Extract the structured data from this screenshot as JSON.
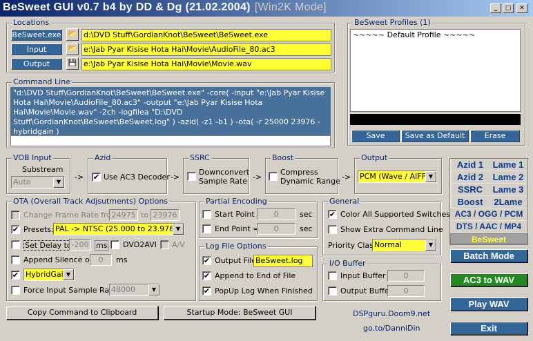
{
  "window": {
    "title": "BeSweet GUI v0.7 b4 by DD & Dg (21.02.2004)",
    "mode": "[Win2K Mode]"
  },
  "locations": {
    "title": "Locations",
    "rows": [
      {
        "label": "BeSweet.exe",
        "path": "d:\\DVD Stuff\\GordianKnot\\BeSweet\\BeSweet.exe"
      },
      {
        "label": "Input",
        "path": "e:\\Jab Pyar Kisise Hota Hai\\Movie\\AudioFile_80.ac3"
      },
      {
        "label": "Output",
        "path": "e:\\Jab Pyar Kisise Hota Hai\\Movie\\Movie.wav"
      }
    ]
  },
  "command_line": {
    "title": "Command Line",
    "text": "\"d:\\DVD Stuff\\GordianKnot\\BeSweet\\BeSweet.exe\" -core( -input \"e:\\Jab Pyar Kisise Hota Hai\\Movie\\AudioFile_80.ac3\" -output \"e:\\Jab Pyar Kisise Hota Hai\\Movie\\Movie.wav\" -2ch -logfilea \"D:\\DVD Stuff\\GordianKnot\\BeSweet\\BeSweet.log\" ) -azid( -z1 -b1 ) -ota( -r 25000 23976 -hybridgain )"
  },
  "profiles": {
    "title": "BeSweet Profiles (1)",
    "items": [
      "~~~~~ Default Profile ~~~~~"
    ],
    "save": "Save",
    "save_default": "Save as Default",
    "erase": "Erase"
  },
  "vob": {
    "title": "VOB Input",
    "substream": "Substream",
    "value": "Auto"
  },
  "azid": {
    "title": "Azid",
    "use_ac3": "Use AC3 Decoder"
  },
  "ssrc": {
    "title": "SSRC",
    "downconvert": "Downconvert",
    "sample_rate": "Sample Rate"
  },
  "boost": {
    "title": "Boost",
    "compress": "Compress",
    "dynamic": "Dynamic Range"
  },
  "output": {
    "title": "Output",
    "value": "PCM (Wave / AIFF"
  },
  "arrows": {
    "a1": "->",
    "a2": "->",
    "a3": "->",
    "a4": "->"
  },
  "ota": {
    "title": "OTA (Overall Track Adjsutments) Options",
    "change_rate": "Change Frame Rate from",
    "from": "24975",
    "to_label": "to",
    "to": "23976",
    "presets_label": "Presets:",
    "presets_value": "PAL    -> NTSC (25.000 to 23.976)",
    "set_delay": "Set Delay to",
    "delay": "-200",
    "ms": "ms",
    "dvd2avi": "DVD2AVI",
    "av": "A/V",
    "append_silence": "Append Silence of",
    "silence": "0",
    "silence_ms": "ms",
    "hybrid": "HybridGain",
    "force_rate": "Force Input Sample Rate",
    "rate": "48000"
  },
  "partial": {
    "title": "Partial Encoding",
    "start": "Start Point =",
    "start_val": "0",
    "end": "End Point =",
    "end_val": "0",
    "sec": "sec"
  },
  "log": {
    "title": "Log File Options",
    "output_file": "Output File",
    "file": "BeSweet.log",
    "append": "Append to End of File",
    "popup": "PopUp Log When Finished"
  },
  "general": {
    "title": "General",
    "color": "Color All Supported Switches",
    "extra": "Show Extra Command Line",
    "priority": "Priority Class",
    "priority_value": "Normal"
  },
  "io": {
    "title": "I/O Buffer",
    "input": "Input Buffer",
    "input_val": "0",
    "output": "Output Buffer",
    "output_val": "0"
  },
  "presets": [
    "Azid 1",
    "Lame 1",
    "Azid 2",
    "Lame 2",
    "SSRC",
    "Lame 3",
    "Boost",
    "2Lame"
  ],
  "formats": [
    "AC3 / OGG / PCM",
    "DTS / AAC / MP4"
  ],
  "besweet_tab": "BeSweet",
  "buttons": {
    "batch": "Batch Mode",
    "ac3wav": "AC3 to WAV",
    "playwav": "Play WAV",
    "exit": "Exit",
    "copy": "Copy Command to Clipboard",
    "startup": "Startup Mode: BeSweet GUI"
  },
  "links": {
    "doom9": "DSPguru.Doom9.net",
    "dannidin": "go.to/DanniDin"
  },
  "colors": {
    "accent": "#336699",
    "field": "#ffff33",
    "title_start": "#0a246a"
  }
}
